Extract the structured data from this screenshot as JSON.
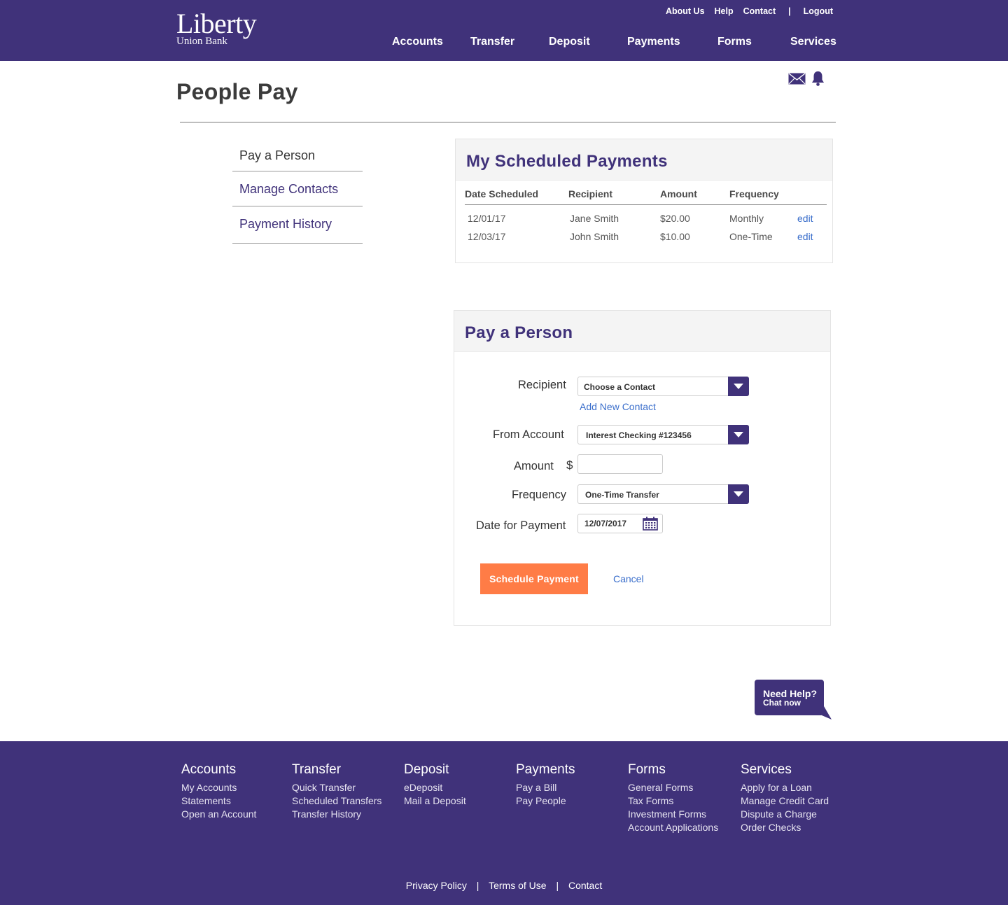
{
  "brand": {
    "name": "Liberty",
    "sub": "Union Bank"
  },
  "util_nav": {
    "about": "About Us",
    "help": "Help",
    "contact": "Contact",
    "sep": "|",
    "logout": "Logout"
  },
  "main_nav": [
    "Accounts",
    "Transfer",
    "Deposit",
    "Payments",
    "Forms",
    "Services"
  ],
  "page": {
    "title": "People Pay"
  },
  "icons": {
    "mail": "mail-icon",
    "bell": "bell-icon",
    "calendar": "calendar-icon"
  },
  "side_menu": [
    {
      "label": "Pay a Person",
      "active": true
    },
    {
      "label": "Manage Contacts"
    },
    {
      "label": "Payment History"
    }
  ],
  "scheduled": {
    "title": "My Scheduled Payments",
    "columns": [
      "Date Scheduled",
      "Recipient",
      "Amount",
      "Frequency"
    ],
    "rows": [
      {
        "date": "12/01/17",
        "recipient": "Jane Smith",
        "amount": "$20.00",
        "frequency": "Monthly",
        "action": "edit"
      },
      {
        "date": "12/03/17",
        "recipient": "John Smith",
        "amount": "$10.00",
        "frequency": "One-Time",
        "action": "edit"
      }
    ]
  },
  "pay_form": {
    "title": "Pay a Person",
    "recipient_label": "Recipient",
    "recipient_value": "Choose a Contact",
    "add_contact": "Add New Contact",
    "from_label": "From Account",
    "from_value": "Interest Checking #123456",
    "amount_label": "Amount",
    "currency": "$",
    "amount_value": "",
    "frequency_label": "Frequency",
    "frequency_value": "One-Time Transfer",
    "date_label": "Date for Payment",
    "date_value": "12/07/2017",
    "submit": "Schedule Payment",
    "cancel": "Cancel"
  },
  "chat": {
    "line1": "Need Help?",
    "line2": "Chat now"
  },
  "footer": {
    "columns": [
      {
        "heading": "Accounts",
        "links": [
          "My Accounts",
          "Statements",
          "Open an Account"
        ]
      },
      {
        "heading": "Transfer",
        "links": [
          "Quick Transfer",
          "Scheduled Transfers",
          "Transfer History"
        ]
      },
      {
        "heading": "Deposit",
        "links": [
          "eDeposit",
          "Mail a Deposit"
        ]
      },
      {
        "heading": "Payments",
        "links": [
          "Pay a Bill",
          "Pay People"
        ]
      },
      {
        "heading": "Forms",
        "links": [
          "General Forms",
          "Tax Forms",
          "Investment Forms",
          "Account Applications"
        ]
      },
      {
        "heading": "Services",
        "links": [
          "Apply for a Loan",
          "Manage Credit Card",
          "Dispute a Charge",
          "Order Checks"
        ]
      }
    ],
    "legal": {
      "privacy": "Privacy Policy",
      "terms": "Terms of Use",
      "contact": "Contact",
      "sep": "|"
    }
  },
  "colors": {
    "brand": "#40327a",
    "accent": "#ff7c46",
    "link": "#3a6ecb"
  }
}
